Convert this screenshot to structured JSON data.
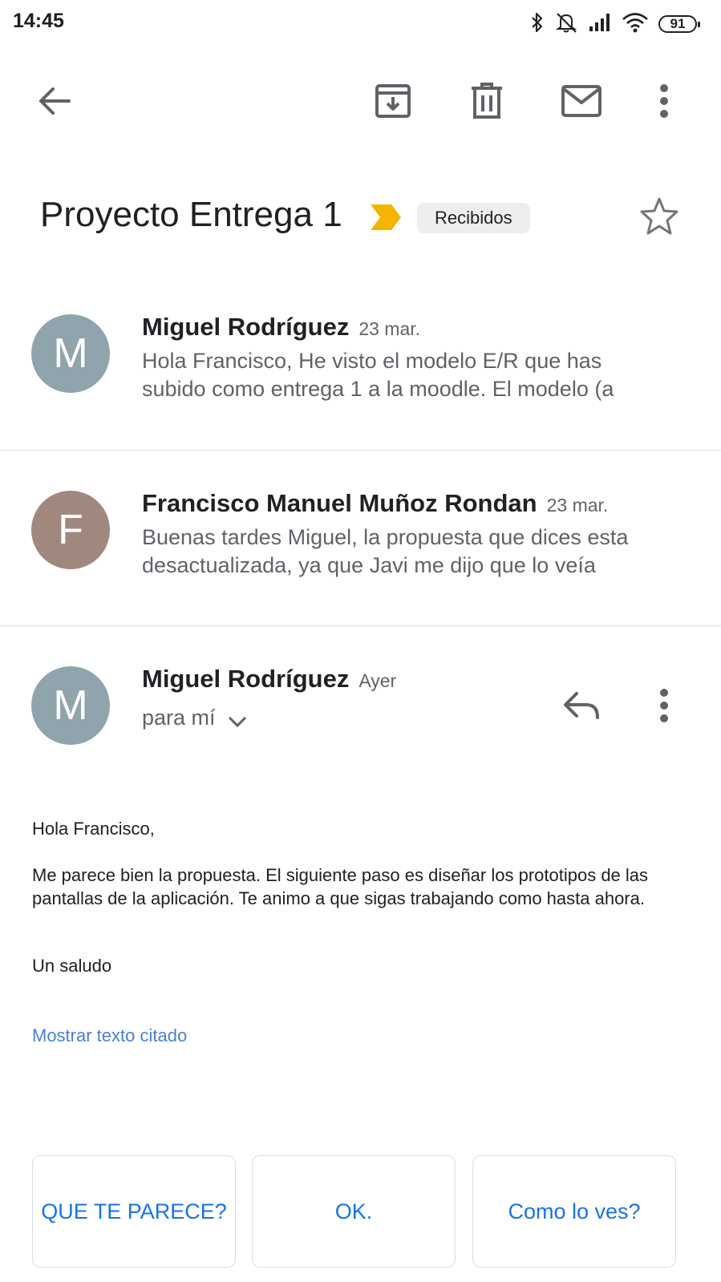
{
  "status_bar": {
    "time": "14:45",
    "battery": "91",
    "icons": [
      "bluetooth-icon",
      "alarm-off-icon",
      "signal-icon",
      "wifi-icon",
      "battery-icon"
    ]
  },
  "toolbar": {
    "icons": [
      "back-arrow-icon",
      "archive-icon",
      "delete-icon",
      "mark-unread-icon",
      "more-vert-icon"
    ]
  },
  "thread": {
    "subject": "Proyecto Entrega 1",
    "label": "Recibidos",
    "importance_color": "#f4b400"
  },
  "messages": [
    {
      "initial": "M",
      "avatar_color": "#90a4ae",
      "sender": "Miguel Rodríguez",
      "date": "23 mar.",
      "snippet_line1": "Hola Francisco, He visto el modelo E/R que has",
      "snippet_line2": "subido como entrega 1 a la moodle. El modelo (a"
    },
    {
      "initial": "F",
      "avatar_color": "#a1887f",
      "sender": "Francisco Manuel Muñoz Rondan",
      "date": "23 mar.",
      "snippet_line1": "Buenas tardes Miguel, la propuesta que dices esta",
      "snippet_line2": "desactualizada, ya que Javi me dijo que lo veía"
    },
    {
      "initial": "M",
      "avatar_color": "#90a4ae",
      "sender": "Miguel Rodríguez",
      "date": "Ayer",
      "recipient": "para mí"
    }
  ],
  "expanded_message": {
    "greeting": "Hola Francisco,",
    "paragraph": "Me parece bien la propuesta. El siguiente paso es diseñar los prototipos de las pantallas de la aplicación. Te animo a que sigas trabajando como hasta ahora.",
    "closing": "Un saludo",
    "show_quoted": "Mostrar texto citado"
  },
  "smart_replies": [
    "QUE TE PARECE?",
    "OK.",
    "Como lo ves?"
  ]
}
